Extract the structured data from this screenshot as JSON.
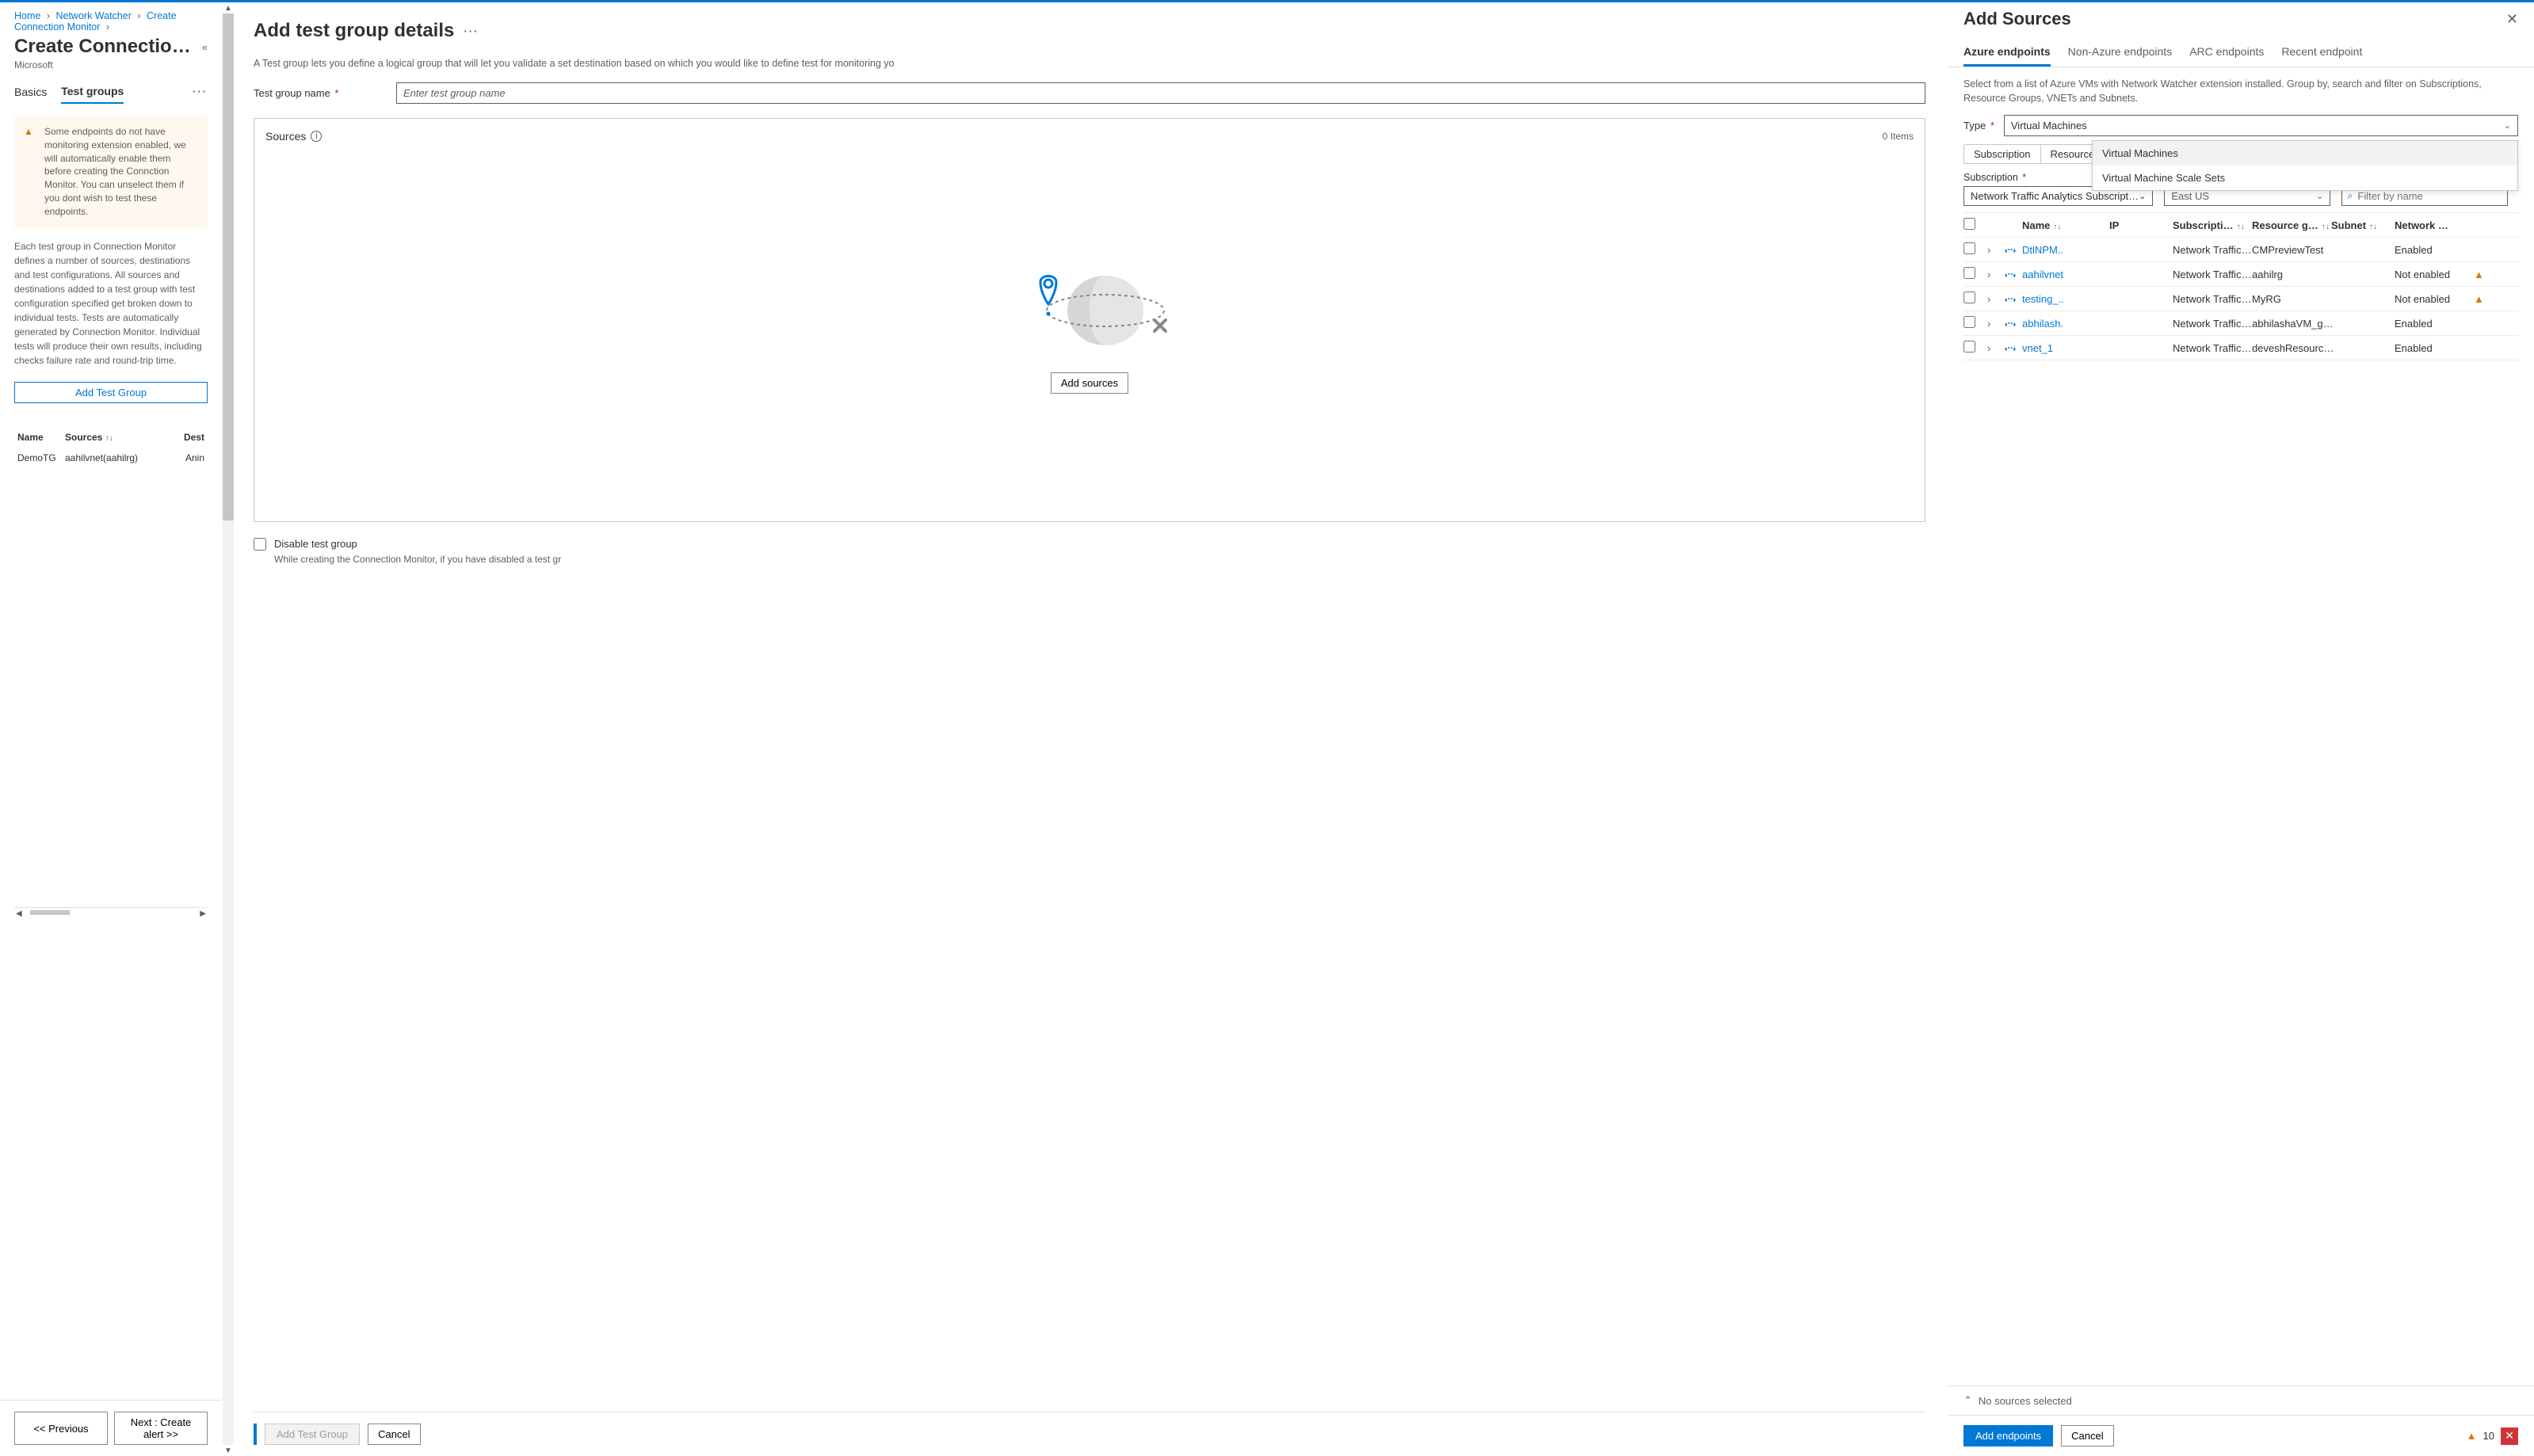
{
  "breadcrumb": {
    "home": "Home",
    "nw": "Network Watcher",
    "ccm": "Create Connection Monitor"
  },
  "left": {
    "title": "Create Connection…",
    "subtitle": "Microsoft",
    "tabs": {
      "basics": "Basics",
      "testgroups": "Test groups"
    },
    "warning": "Some endpoints do not have monitoring extension enabled, we will automatically enable them before creating the Connction Monitor. You can unselect them if you dont wish to test these endpoints.",
    "desc": "Each test group in Connection Monitor defines a number of sources, destinations and test configurations. All sources and destinations added to a test group with test configuration specified get broken down to individual tests. Tests are automatically generated by Connection Monitor. Individual tests will produce their own results, including checks failure rate and round-trip time.",
    "add_btn": "Add Test Group",
    "table": {
      "hdr": {
        "name": "Name",
        "sources": "Sources",
        "dest": "Dest"
      },
      "row": {
        "name": "DemoTG",
        "sources": "aahilvnet(aahilrg)",
        "dest": "Anin"
      }
    },
    "footer": {
      "prev": "<<  Previous",
      "next": "Next : Create alert  >>"
    }
  },
  "mid": {
    "title": "Add test group details",
    "desc": "A Test group lets you define a logical group that will let you validate a set destination based on which you would like to define test for monitoring yo",
    "label_tgname": "Test group name",
    "ph_tgname": "Enter test group name",
    "sources_label": "Sources",
    "sources_count": "0 Items",
    "add_sources_btn": "Add sources",
    "disable_label": "Disable test group",
    "disable_sub": "While creating the Connection Monitor, if you have disabled a test gr",
    "footer": {
      "add": "Add Test Group",
      "cancel": "Cancel"
    }
  },
  "right": {
    "title": "Add Sources",
    "tabs": {
      "azure": "Azure endpoints",
      "nonazure": "Non-Azure endpoints",
      "arc": "ARC endpoints",
      "recent": "Recent endpoint"
    },
    "desc": "Select from a list of Azure VMs with Network Watcher extension installed. Group by, search and filter on Subscriptions, Resource Groups, VNETs and Subnets.",
    "type_label": "Type",
    "type_value": "Virtual Machines",
    "type_options": {
      "vm": "Virtual Machines",
      "vmss": "Virtual Machine Scale Sets"
    },
    "segments": {
      "sub": "Subscription",
      "rg": "Resource grou"
    },
    "filters": {
      "sub_label": "Subscription",
      "sub_value": "Network Traffic Analytics Subscript…",
      "region_value": "East US",
      "filter_ph": "Filter by name"
    },
    "grid": {
      "hdr": {
        "name": "Name",
        "ip": "IP",
        "sub": "Subscripti…",
        "rg": "Resource g…",
        "sn": "Subnet",
        "nw": "Network …"
      },
      "rows": [
        {
          "name": "DtlNPM..",
          "sub": "Network Traffic…",
          "rg": "CMPreviewTest",
          "nw": "Enabled",
          "warn": false
        },
        {
          "name": "aahilvnet",
          "sub": "Network Traffic…",
          "rg": "aahilrg",
          "nw": "Not enabled",
          "warn": true
        },
        {
          "name": "testing_..",
          "sub": "Network Traffic…",
          "rg": "MyRG",
          "nw": "Not enabled",
          "warn": true
        },
        {
          "name": "abhilash.",
          "sub": "Network Traffic…",
          "rg": "abhilashaVM_g…",
          "nw": "Enabled",
          "warn": false
        },
        {
          "name": "vnet_1",
          "sub": "Network Traffic…",
          "rg": "deveshResourc…",
          "nw": "Enabled",
          "warn": false
        }
      ]
    },
    "no_sources": "No sources selected",
    "footer": {
      "add": "Add endpoints",
      "cancel": "Cancel"
    },
    "warn_count": "10"
  }
}
